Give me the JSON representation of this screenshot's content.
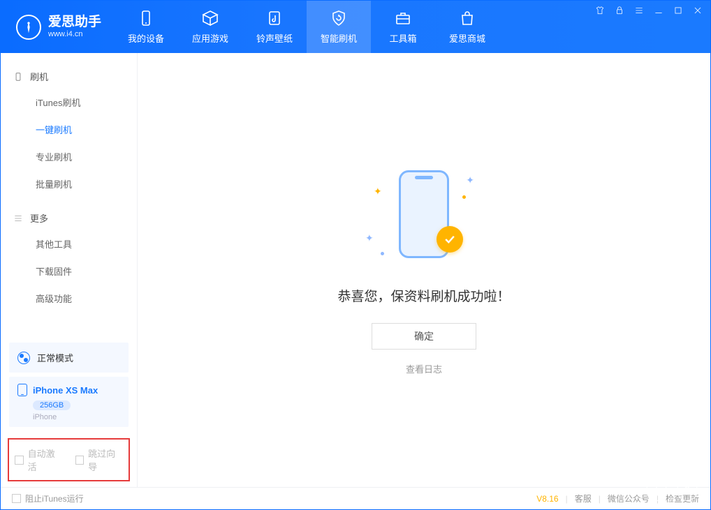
{
  "app": {
    "name": "爱思助手",
    "subtitle": "www.i4.cn",
    "version": "V8.16"
  },
  "nav": {
    "tabs": [
      {
        "label": "我的设备"
      },
      {
        "label": "应用游戏"
      },
      {
        "label": "铃声壁纸"
      },
      {
        "label": "智能刷机"
      },
      {
        "label": "工具箱"
      },
      {
        "label": "爱思商城"
      }
    ],
    "active_index": 3
  },
  "sidebar": {
    "section_flash": "刷机",
    "items_flash": [
      {
        "label": "iTunes刷机"
      },
      {
        "label": "一键刷机"
      },
      {
        "label": "专业刷机"
      },
      {
        "label": "批量刷机"
      }
    ],
    "active_flash_index": 1,
    "section_more": "更多",
    "items_more": [
      {
        "label": "其他工具"
      },
      {
        "label": "下载固件"
      },
      {
        "label": "高级功能"
      }
    ]
  },
  "mode": {
    "label": "正常模式"
  },
  "device": {
    "name": "iPhone XS Max",
    "storage": "256GB",
    "type": "iPhone"
  },
  "bottom_options": {
    "auto_activate": "自动激活",
    "skip_guide": "跳过向导"
  },
  "main": {
    "success_text": "恭喜您，保资料刷机成功啦！",
    "confirm": "确定",
    "view_log": "查看日志"
  },
  "statusbar": {
    "block_itunes": "阻止iTunes运行",
    "links": {
      "support": "客服",
      "wechat": "微信公众号",
      "update": "检查更新"
    }
  }
}
